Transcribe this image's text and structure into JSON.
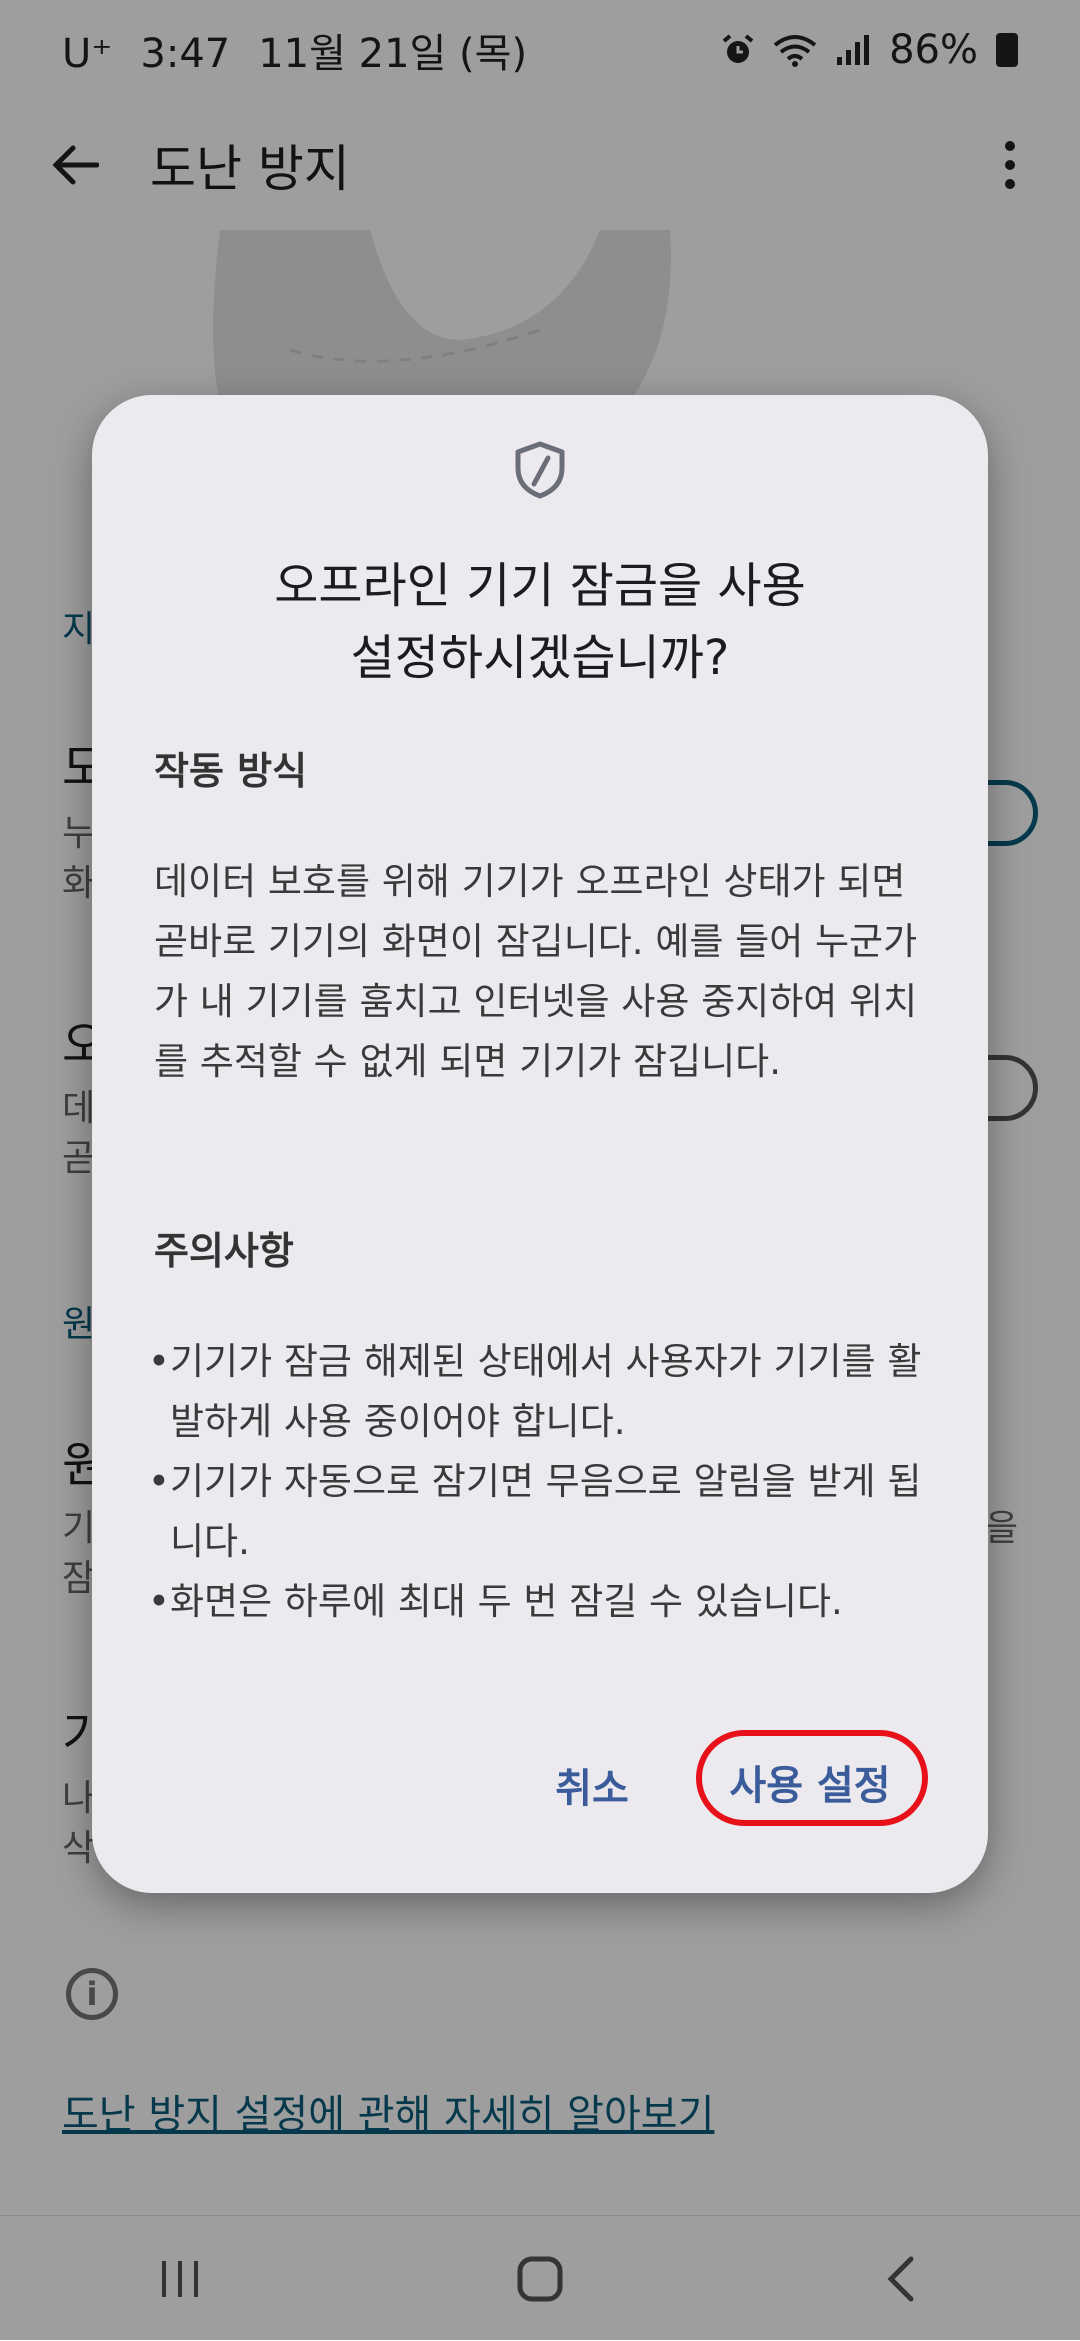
{
  "status_bar": {
    "carrier": "U⁺",
    "time": "3:47",
    "date": "11월 21일 (목)",
    "battery": "86%"
  },
  "app_bar": {
    "title": "도난 방지"
  },
  "background_list": {
    "section1_header": "지",
    "item1_title": "도",
    "item1_desc_line1": "누",
    "item1_desc_line2": "화",
    "item2_title": "오",
    "item2_desc_line1": "데",
    "item2_desc_line2": "곧",
    "section2_header": "원",
    "item3_title": "원",
    "item3_desc_line1": "기",
    "item3_desc_line2": "잠",
    "item3_trailing": "을",
    "item4_title": "기",
    "item4_desc_line1": "나",
    "item4_desc_line2": "삭",
    "learn_more_link": "도난 방지 설정에 관해 자세히 알아보기"
  },
  "dialog": {
    "icon": "shield-icon",
    "title_line1": "오프라인 기기 잠금을 사용",
    "title_line2": "설정하시겠습니까?",
    "how_it_works_heading": "작동 방식",
    "how_it_works_body": "데이터 보호를 위해 기기가 오프라인 상태가 되면 곧바로 기기의 화면이 잠깁니다. 예를 들어 누군가가 내 기기를 훔치고 인터넷을 사용 중지하여 위치를 추적할 수 없게 되면 기기가 잠깁니다.",
    "notes_heading": "주의사항",
    "notes": [
      "기기가 잠금 해제된 상태에서 사용자가 기기를 활발하게 사용 중이어야 합니다.",
      "기기가 자동으로 잠기면 무음으로 알림을 받게 됩니다.",
      "화면은 하루에 최대 두 번 잠길 수 있습니다."
    ],
    "cancel_label": "취소",
    "enable_label": "사용 설정"
  },
  "colors": {
    "accent": "#3b5c9a",
    "highlight": "#e8111a",
    "dialog_bg": "#eceaef",
    "link": "#0a5c7a"
  }
}
